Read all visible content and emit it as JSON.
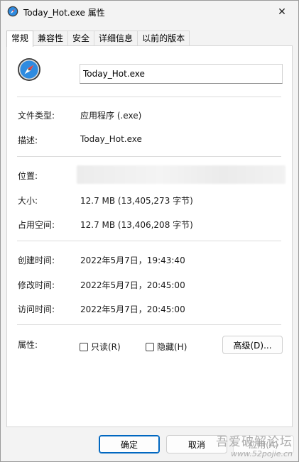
{
  "window": {
    "title": "Today_Hot.exe 属性",
    "close_glyph": "✕"
  },
  "tabs": [
    {
      "label": "常规",
      "active": true
    },
    {
      "label": "兼容性",
      "active": false
    },
    {
      "label": "安全",
      "active": false
    },
    {
      "label": "详细信息",
      "active": false
    },
    {
      "label": "以前的版本",
      "active": false
    }
  ],
  "general": {
    "file_name": "Today_Hot.exe",
    "file_type_label": "文件类型:",
    "file_type_value": "应用程序 (.exe)",
    "description_label": "描述:",
    "description_value": "Today_Hot.exe",
    "location_label": "位置:",
    "size_label": "大小:",
    "size_value": "12.7 MB (13,405,273 字节)",
    "size_on_disk_label": "占用空间:",
    "size_on_disk_value": "12.7 MB (13,406,208 字节)",
    "created_label": "创建时间:",
    "created_value": "2022年5月7日，19:43:40",
    "modified_label": "修改时间:",
    "modified_value": "2022年5月7日，20:45:00",
    "accessed_label": "访问时间:",
    "accessed_value": "2022年5月7日，20:45:00",
    "attributes_label": "属性:",
    "readonly_label": "只读(R)",
    "hidden_label": "隐藏(H)",
    "advanced_label": "高级(D)..."
  },
  "footer": {
    "ok_label": "确定",
    "cancel_label": "取消",
    "apply_label": "应用(A)"
  },
  "watermark": {
    "line1": "吾爱破解论坛",
    "line2": "www.52pojie.cn"
  },
  "colors": {
    "accent": "#0067c0",
    "icon_blue": "#2e8be0"
  }
}
